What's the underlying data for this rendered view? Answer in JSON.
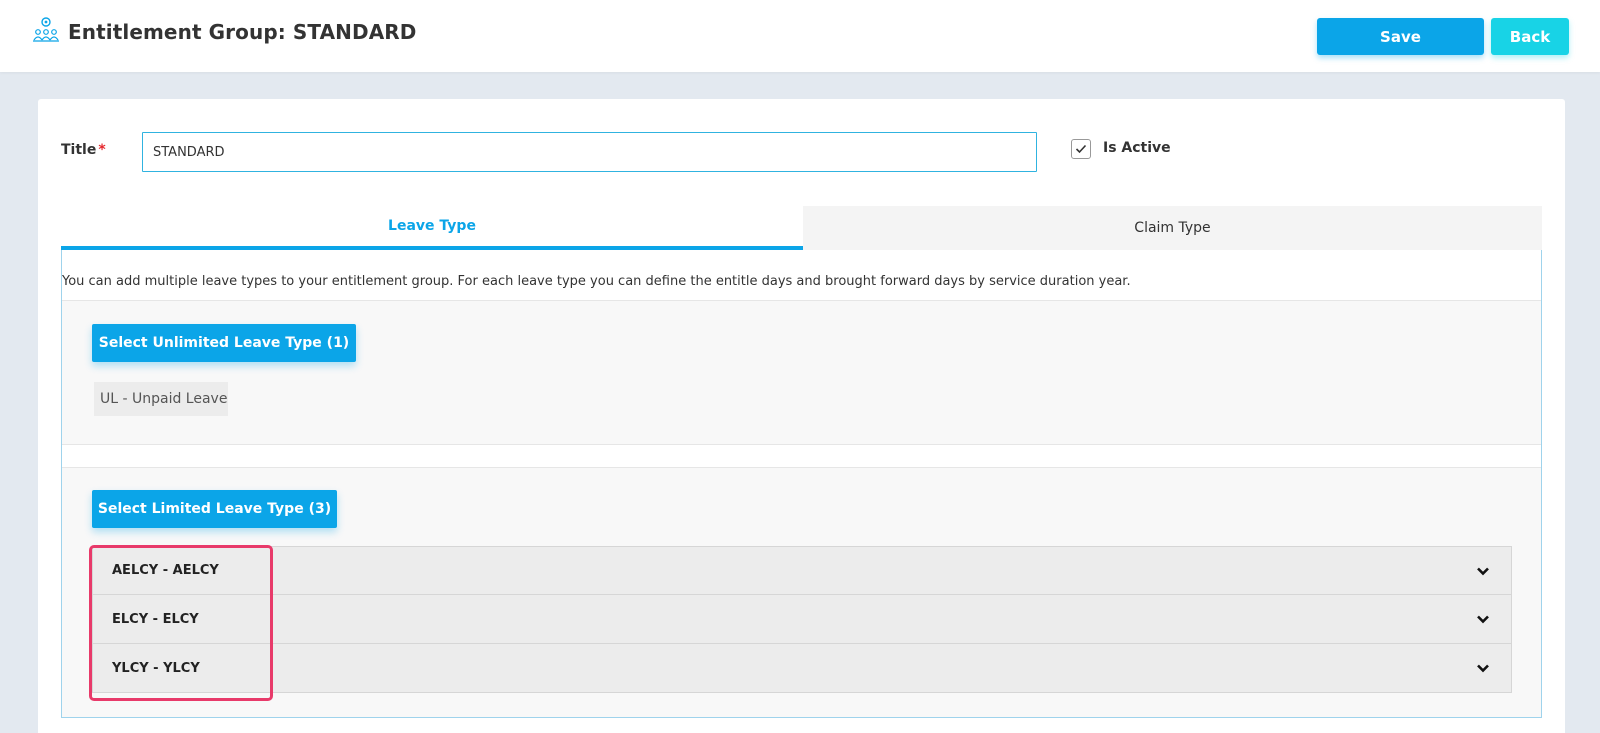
{
  "header": {
    "title": "Entitlement Group: STANDARD",
    "icon": "group-settings-icon",
    "save_label": "Save",
    "back_label": "Back"
  },
  "form": {
    "title_label": "Title",
    "required_marker": "*",
    "title_value": "STANDARD",
    "is_active_label": "Is Active",
    "is_active_checked": true
  },
  "tabs": [
    {
      "label": "Leave Type",
      "active": true
    },
    {
      "label": "Claim Type",
      "active": false
    }
  ],
  "leave_tab": {
    "description": "You can add multiple leave types to your entitlement group. For each leave type you can define the entitle days and brought forward days by service duration year.",
    "unlimited_button": "Select Unlimited Leave Type (1)",
    "unlimited_items": [
      "UL - Unpaid Leave"
    ],
    "limited_button": "Select Limited Leave Type (3)",
    "limited_items": [
      "AELCY - AELCY",
      "ELCY - ELCY",
      "YLCY - YLCY"
    ]
  },
  "colors": {
    "primary": "#0ba5e8",
    "secondary": "#18d3e6",
    "required": "#e5262b",
    "highlight": "#e83a6a"
  }
}
